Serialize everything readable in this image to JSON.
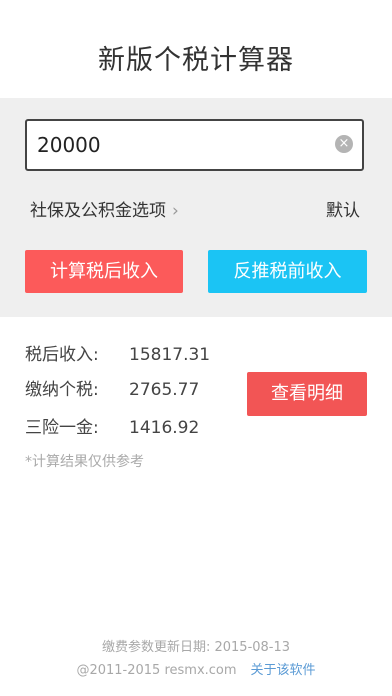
{
  "header": {
    "title": "新版个税计算器"
  },
  "input": {
    "value": "20000",
    "clear_icon": "×"
  },
  "options": {
    "social_label": "社保及公积金选项",
    "chevron": "›",
    "default_label": "默认"
  },
  "buttons": {
    "after_tax": "计算税后收入",
    "before_tax": "反推税前收入",
    "detail": "查看明细"
  },
  "results": {
    "rows": [
      {
        "label": "税后收入:",
        "value": "15817.31"
      },
      {
        "label": "缴纳个税:",
        "value": "2765.77"
      },
      {
        "label": "三险一金:",
        "value": "1416.92"
      }
    ],
    "note": "*计算结果仅供参考"
  },
  "footer": {
    "update_text": "缴费参数更新日期:  2015-08-13",
    "copyright": "@2011-2015 resmx.com",
    "about_link": "关于该软件"
  },
  "colors": {
    "red_button": "#fc5a5a",
    "blue_button": "#1bc4f4",
    "link": "#5b9bd5"
  }
}
